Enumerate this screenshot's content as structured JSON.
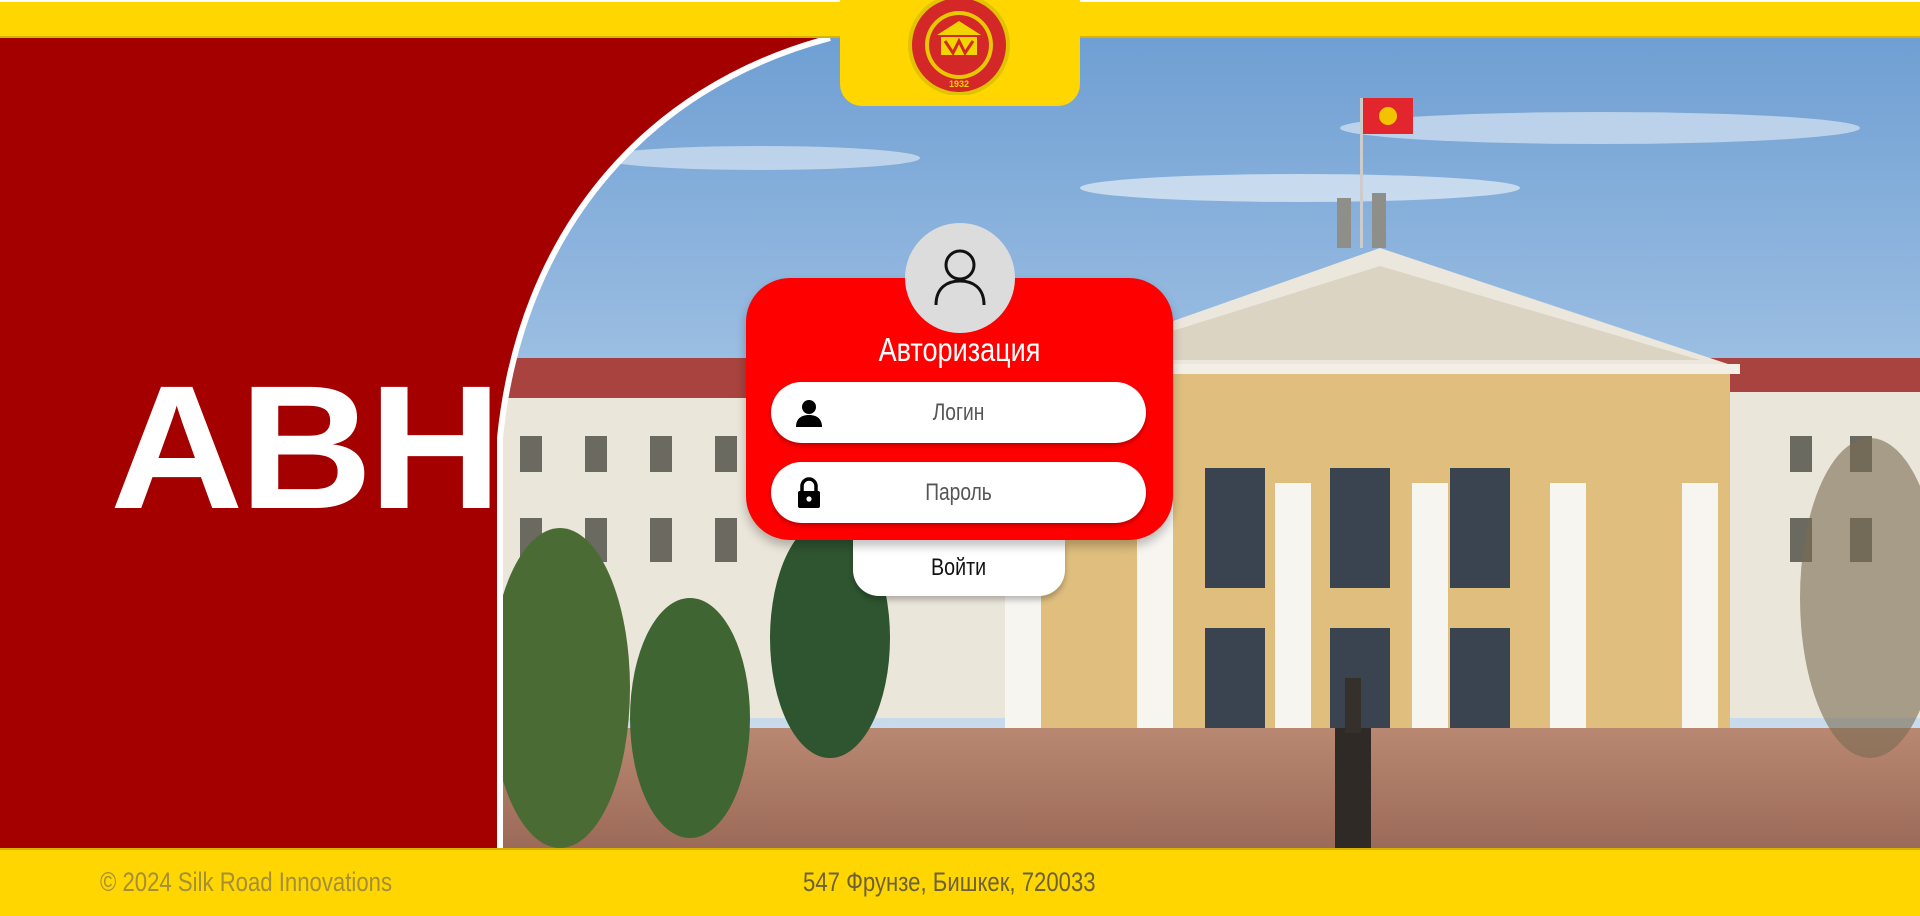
{
  "brand": {
    "title": "АВН"
  },
  "auth_card": {
    "title": "Авторизация",
    "login_placeholder": "Логин",
    "password_placeholder": "Пароль",
    "submit_label": "Войти"
  },
  "footer": {
    "copyright": "© 2024 Silk Road Innovations",
    "address": "547 Фрунзе, Бишкек, 720033"
  },
  "logo": {
    "year": "1932"
  },
  "colors": {
    "accent_yellow": "#FFD600",
    "brand_red": "#A50000",
    "card_red": "#FF0000"
  },
  "icons": [
    "university-seal-logo",
    "user-avatar-icon",
    "user-icon",
    "lock-icon"
  ]
}
